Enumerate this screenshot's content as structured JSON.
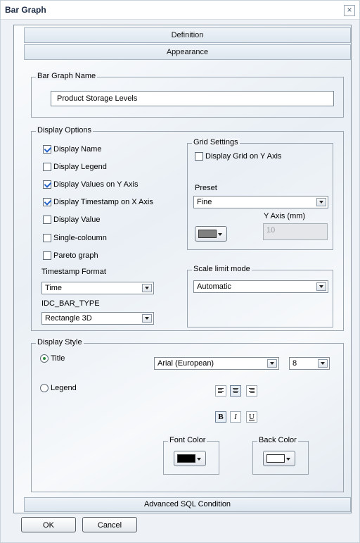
{
  "window": {
    "title": "Bar Graph"
  },
  "tabs": {
    "definition": "Definition",
    "appearance": "Appearance",
    "advanced": "Advanced SQL Condition"
  },
  "bar_graph_name": {
    "legend": "Bar Graph Name",
    "value": "Product Storage Levels"
  },
  "display_options": {
    "legend": "Display Options",
    "items": [
      {
        "label": "Display Name",
        "checked": true
      },
      {
        "label": "Display Legend",
        "checked": false
      },
      {
        "label": "Display Values on Y Axis",
        "checked": true
      },
      {
        "label": "Display Timestamp on X Axis",
        "checked": true
      },
      {
        "label": "Display Value",
        "checked": false
      },
      {
        "label": "Single-coloumn",
        "checked": false
      },
      {
        "label": "Pareto graph",
        "checked": false
      }
    ],
    "timestamp_format_label": "Timestamp Format",
    "timestamp_format_value": "Time",
    "bar_type_label": "IDC_BAR_TYPE",
    "bar_type_value": "Rectangle 3D"
  },
  "grid_settings": {
    "legend": "Grid Settings",
    "display_grid_label": "Display Grid on Y Axis",
    "display_grid_checked": false,
    "preset_label": "Preset",
    "preset_value": "Fine",
    "y_axis_label": "Y Axis (mm)",
    "y_axis_value": "10",
    "grid_color": "#808080"
  },
  "scale_limit": {
    "legend": "Scale limit mode",
    "value": "Automatic"
  },
  "display_style": {
    "legend": "Display Style",
    "title_radio": "Title",
    "legend_radio": "Legend",
    "font_value": "Arial (European)",
    "size_value": "8",
    "bold": "B",
    "italic": "I",
    "underline": "U",
    "font_color_label": "Font Color",
    "font_color": "#000000",
    "back_color_label": "Back Color",
    "back_color": "#ffffff"
  },
  "buttons": {
    "ok": "OK",
    "cancel": "Cancel"
  }
}
